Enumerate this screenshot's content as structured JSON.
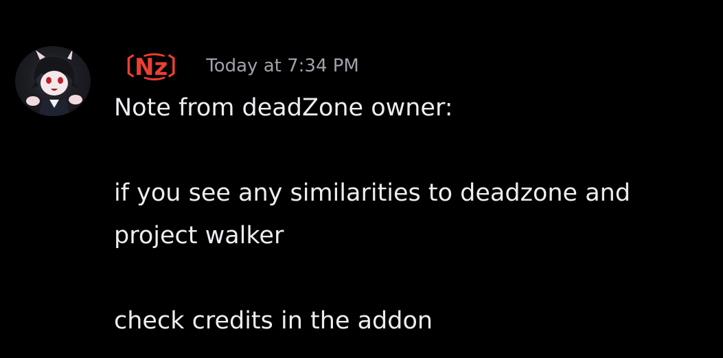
{
  "message": {
    "author": {
      "name": "〔N͜͡z〕",
      "color": "#ec3f31"
    },
    "timestamp": "Today at 7:34 PM",
    "lines": [
      "Note from deadZone owner:",
      "",
      "if you see any similarities to deadzone and",
      "project walker",
      "",
      "check credits in the addon"
    ]
  }
}
